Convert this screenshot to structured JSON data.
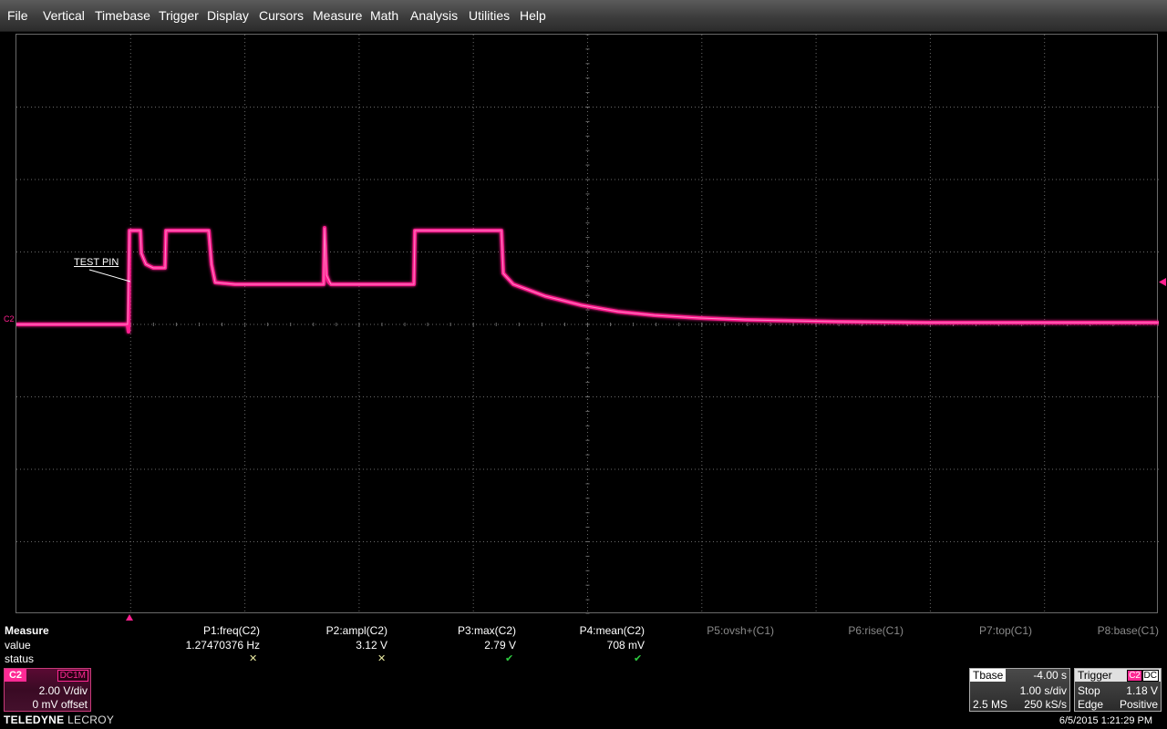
{
  "menu": [
    "File",
    "Vertical",
    "Timebase",
    "Trigger",
    "Display",
    "Cursors",
    "Measure",
    "Math",
    "Analysis",
    "Utilities",
    "Help"
  ],
  "annotation": {
    "label": "TEST PIN"
  },
  "channel_marker": "C2",
  "measure": {
    "title": "Measure",
    "row_value": "value",
    "row_status": "status",
    "params": [
      {
        "name": "P1:freq(C2)",
        "value": "1.27470376 Hz",
        "status": "warn"
      },
      {
        "name": "P2:ampl(C2)",
        "value": "3.12 V",
        "status": "warn"
      },
      {
        "name": "P3:max(C2)",
        "value": "2.79 V",
        "status": "ok"
      },
      {
        "name": "P4:mean(C2)",
        "value": "708 mV",
        "status": "ok"
      },
      {
        "name": "P5:ovsh+(C1)",
        "value": "",
        "status": ""
      },
      {
        "name": "P6:rise(C1)",
        "value": "",
        "status": ""
      },
      {
        "name": "P7:top(C1)",
        "value": "",
        "status": ""
      },
      {
        "name": "P8:base(C1)",
        "value": "",
        "status": ""
      }
    ]
  },
  "channel": {
    "name": "C2",
    "coupling": "DC1M",
    "vdiv": "2.00 V/div",
    "offset": "0 mV offset"
  },
  "logo": {
    "brand": "TELEDYNE",
    "product": "LECROY"
  },
  "timebase": {
    "title": "Tbase",
    "delay": "-4.00 s",
    "sdiv": "1.00 s/div",
    "samples": "2.5 MS",
    "rate": "250 kS/s"
  },
  "trigger": {
    "title": "Trigger",
    "source": "C2",
    "coupling": "DC",
    "mode": "Stop",
    "level": "1.18 V",
    "type": "Edge",
    "slope": "Positive"
  },
  "timestamp": "6/5/2015 1:21:29 PM",
  "colors": {
    "trace": "#ff1f8f",
    "grid": "#6a6a6a",
    "ok": "#2ecc40",
    "warn": "#e8e8a0"
  }
}
